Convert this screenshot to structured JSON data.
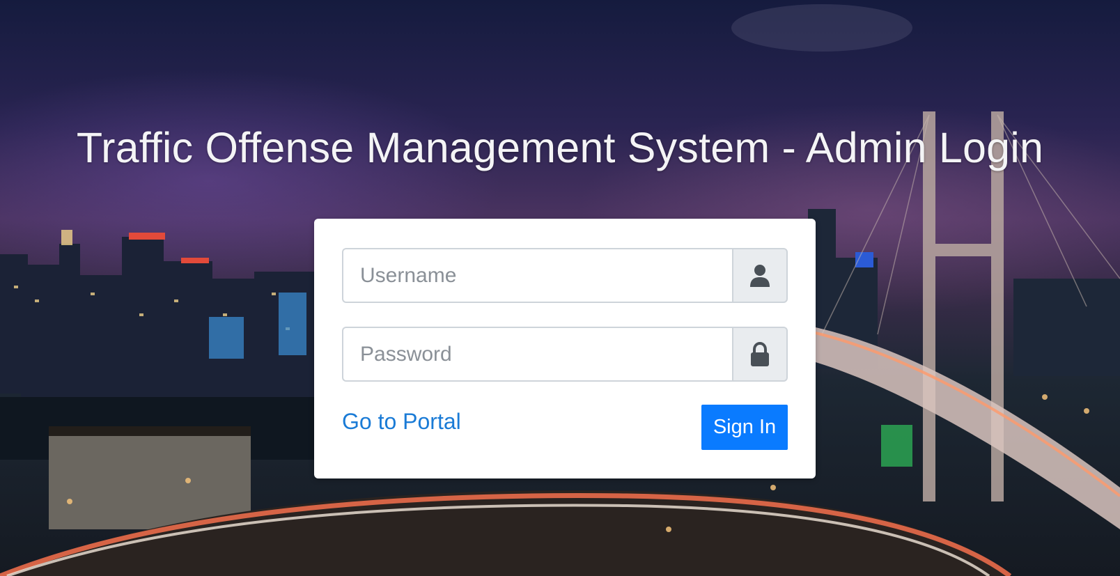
{
  "page": {
    "title": "Traffic Offense Management System - Admin Login"
  },
  "login": {
    "username_placeholder": "Username",
    "password_placeholder": "Password",
    "portal_link_label": "Go to Portal",
    "sign_in_label": "Sign In"
  },
  "icons": {
    "username": "user-icon",
    "password": "lock-icon"
  },
  "colors": {
    "primary": "#0a7bff",
    "link": "#1a7bd6",
    "addon_background": "#e9ecef",
    "icon": "#495057"
  }
}
